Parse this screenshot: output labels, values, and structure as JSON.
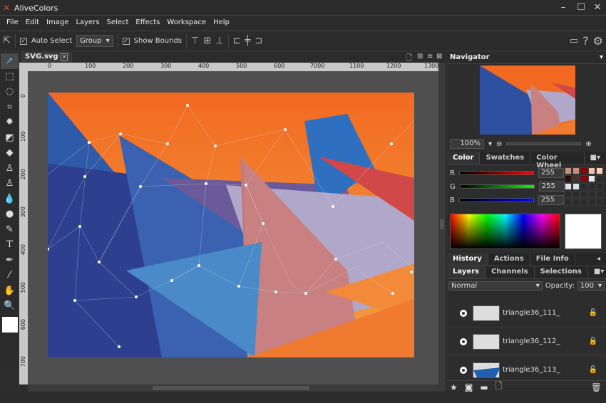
{
  "app": {
    "title": "AliveColors"
  },
  "menu": [
    "File",
    "Edit",
    "Image",
    "Layers",
    "Select",
    "Effects",
    "Workspace",
    "Help"
  ],
  "options": {
    "auto_select": "Auto Select",
    "auto_select_checked": true,
    "group_value": "Group",
    "show_bounds": "Show Bounds",
    "show_bounds_checked": true
  },
  "document": {
    "tab": "SVG.svg",
    "ruler_top": [
      "0",
      "100",
      "200",
      "300",
      "400",
      "500",
      "600",
      "7000",
      "1100",
      "1200",
      "1300"
    ],
    "ruler_left": [
      "0",
      "100",
      "200",
      "300",
      "400",
      "500",
      "600",
      "700"
    ]
  },
  "navigator": {
    "title": "Navigator",
    "zoom": "100%"
  },
  "color_panel": {
    "tabs": [
      "Color",
      "Swatches",
      "Color Wheel"
    ],
    "active": "Color",
    "channels": [
      {
        "label": "R",
        "value": "255",
        "color": "#ff0000"
      },
      {
        "label": "G",
        "value": "255",
        "color": "#00ff00"
      },
      {
        "label": "B",
        "value": "255",
        "color": "#0000ff"
      }
    ],
    "current_color": "#ffffff",
    "swatches": [
      "#c89078",
      "#c8907a",
      "#8b0000",
      "#f0c0a8",
      "#f8d0b0",
      "#2a0a0a",
      "#4a3030",
      "#8b0000",
      "#e8e8ec",
      "#2a2a2a",
      "#e0e0e8",
      "#d8e0e8"
    ]
  },
  "history_tabs": [
    "History",
    "Actions",
    "File Info"
  ],
  "layers_panel": {
    "tabs": [
      "Layers",
      "Channels",
      "Selections"
    ],
    "blend_mode": "Normal",
    "opacity_label": "Opacity:",
    "opacity": "100",
    "layers": [
      {
        "name": "triangle36_111_"
      },
      {
        "name": "triangle36_112_"
      },
      {
        "name": "triangle36_113_"
      }
    ]
  }
}
